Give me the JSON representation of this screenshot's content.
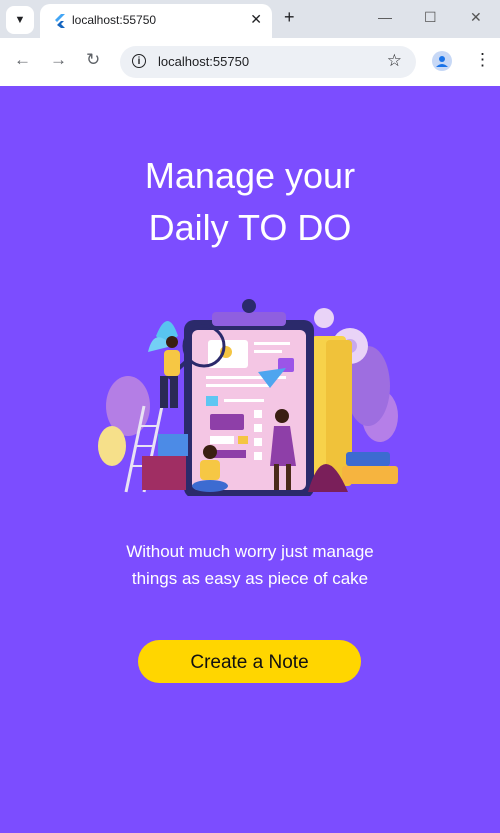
{
  "browser": {
    "tab_title": "localhost:55750",
    "url": "localhost:55750"
  },
  "page": {
    "title_line1": "Manage your",
    "title_line2": "Daily TO DO",
    "subtitle_line1": "Without much worry just manage",
    "subtitle_line2": "things as easy as piece of cake",
    "cta_label": "Create a Note"
  },
  "colors": {
    "background": "#7c4dff",
    "cta": "#ffd600"
  }
}
